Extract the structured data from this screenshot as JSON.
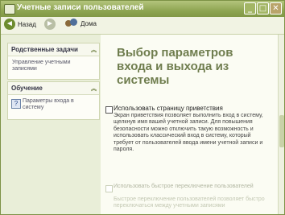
{
  "window": {
    "title": "Учетные записи пользователей",
    "min_glyph": "_",
    "max_glyph": "□",
    "close_glyph": "✕"
  },
  "toolbar": {
    "back_label": "Назад",
    "back_glyph": "◄",
    "forward_glyph": "►",
    "home_label": "Дома"
  },
  "tasks_panel": {
    "title": "Родственные задачи",
    "chevron": "︽",
    "item": "Управление учетными записями"
  },
  "learn_panel": {
    "title": "Обучение",
    "chevron": "︽",
    "help_glyph": "?",
    "item": "Параметры входа в систему"
  },
  "main": {
    "heading": "Выбор параметров входа и выхода из системы",
    "option1_label": "Использовать страницу приветствия",
    "option1_desc": "Экран приветствия позволяет выполнить вход в систему, щелкнув имя вашей учетной записи. Для повышения безопасности можно отключить такую возможность и использовать классический вход в систему, который требует от пользователей ввода имени учетной записи и пароля.",
    "option2_label": "Использовать быстрое переключение пользователей",
    "option2_desc": "Быстрое переключение пользователей позволяет быстро переключаться между учетными записями"
  }
}
